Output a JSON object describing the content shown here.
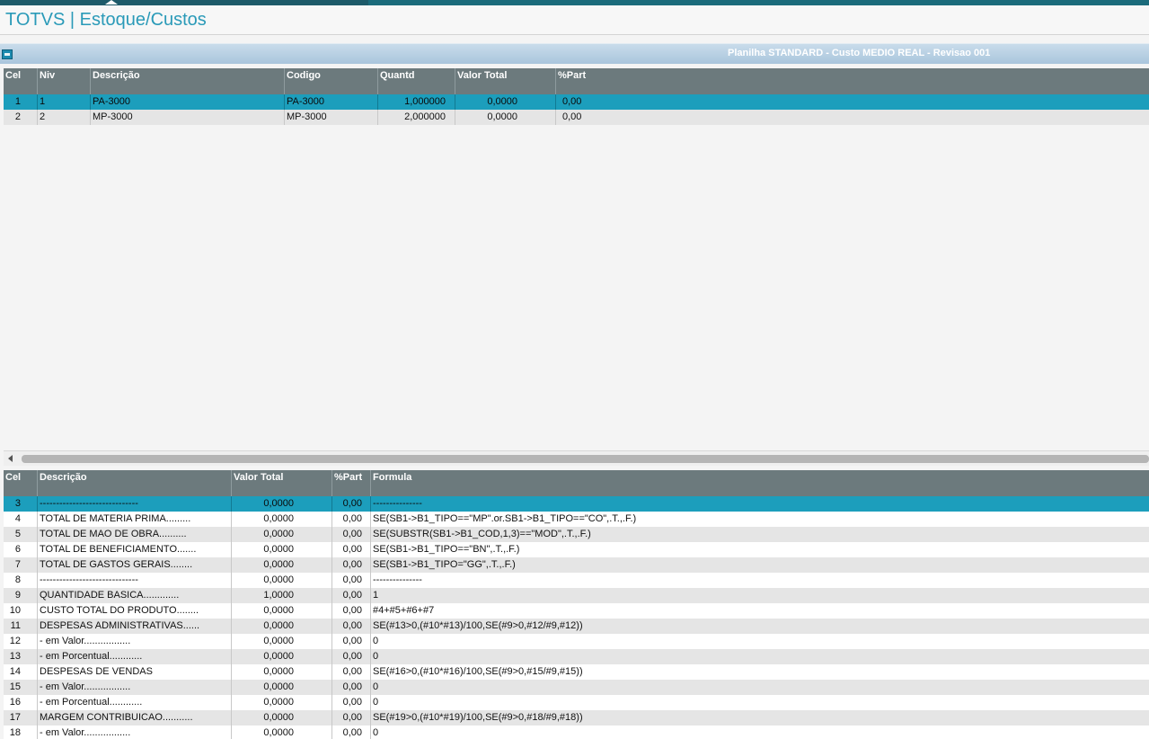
{
  "app": {
    "title": "TOTVS | Estoque/Custos"
  },
  "window": {
    "subtitle": "Planilha STANDARD - Custo MEDIO REAL - Revisao 001"
  },
  "top_table": {
    "headers": {
      "cel": "Cel",
      "niv": "Niv",
      "descricao": "Descrição",
      "codigo": "Codigo",
      "quantd": "Quantd",
      "valor_total": "Valor Total",
      "part": "%Part"
    },
    "rows": [
      {
        "cel": "1",
        "niv": "1",
        "descricao": "PA-3000",
        "codigo": "PA-3000",
        "quantd": "1,000000",
        "valor_total": "0,0000",
        "part": "0,00"
      },
      {
        "cel": "2",
        "niv": " 2",
        "descricao": "MP-3000",
        "codigo": "MP-3000",
        "quantd": "2,000000",
        "valor_total": "0,0000",
        "part": "0,00"
      }
    ]
  },
  "bottom_table": {
    "headers": {
      "cel": "Cel",
      "descricao": "Descrição",
      "valor_total": "Valor Total",
      "part": "%Part",
      "formula": "Formula"
    },
    "rows": [
      {
        "cel": "3",
        "descricao": "------------------------------",
        "valor_total": "0,0000",
        "part": "0,00",
        "formula": "---------------"
      },
      {
        "cel": "4",
        "descricao": "TOTAL DE MATERIA PRIMA.........",
        "valor_total": "0,0000",
        "part": "0,00",
        "formula": "SE(SB1->B1_TIPO==\"MP\".or.SB1->B1_TIPO==\"CO\",.T.,.F.)"
      },
      {
        "cel": "5",
        "descricao": "TOTAL DE MAO DE OBRA..........",
        "valor_total": "0,0000",
        "part": "0,00",
        "formula": "SE(SUBSTR(SB1->B1_COD,1,3)==\"MOD\",.T.,.F.)"
      },
      {
        "cel": "6",
        "descricao": "TOTAL DE BENEFICIAMENTO.......",
        "valor_total": "0,0000",
        "part": "0,00",
        "formula": "SE(SB1->B1_TIPO==\"BN\",.T.,.F.)"
      },
      {
        "cel": "7",
        "descricao": "TOTAL DE GASTOS GERAIS........",
        "valor_total": "0,0000",
        "part": "0,00",
        "formula": "SE(SB1->B1_TIPO=\"GG\",.T.,.F.)"
      },
      {
        "cel": "8",
        "descricao": "------------------------------",
        "valor_total": "0,0000",
        "part": "0,00",
        "formula": "---------------"
      },
      {
        "cel": "9",
        "descricao": "QUANTIDADE BASICA.............",
        "valor_total": "1,0000",
        "part": "0,00",
        "formula": "1"
      },
      {
        "cel": "10",
        "descricao": "CUSTO TOTAL DO PRODUTO........",
        "valor_total": "0,0000",
        "part": "0,00",
        "formula": "#4+#5+#6+#7"
      },
      {
        "cel": "11",
        "descricao": "DESPESAS ADMINISTRATIVAS......",
        "valor_total": "0,0000",
        "part": "0,00",
        "formula": "SE(#13>0,(#10*#13)/100,SE(#9>0,#12/#9,#12))"
      },
      {
        "cel": "12",
        "descricao": "   - em Valor.................",
        "valor_total": "0,0000",
        "part": "0,00",
        "formula": "0"
      },
      {
        "cel": "13",
        "descricao": "   - em Porcentual............",
        "valor_total": "0,0000",
        "part": "0,00",
        "formula": "0"
      },
      {
        "cel": "14",
        "descricao": "DESPESAS DE VENDAS",
        "valor_total": "0,0000",
        "part": "0,00",
        "formula": "SE(#16>0,(#10*#16)/100,SE(#9>0,#15/#9,#15))"
      },
      {
        "cel": "15",
        "descricao": "   - em Valor.................",
        "valor_total": "0,0000",
        "part": "0,00",
        "formula": "0"
      },
      {
        "cel": "16",
        "descricao": "   - em Porcentual............",
        "valor_total": "0,0000",
        "part": "0,00",
        "formula": "0"
      },
      {
        "cel": "17",
        "descricao": "MARGEM CONTRIBUICAO...........",
        "valor_total": "0,0000",
        "part": "0,00",
        "formula": "SE(#19>0,(#10*#19)/100,SE(#9>0,#18/#9,#18))"
      },
      {
        "cel": "18",
        "descricao": "   - em Valor.................",
        "valor_total": "0,0000",
        "part": "0,00",
        "formula": "0"
      }
    ]
  },
  "colors": {
    "accent": "#2a9ab8",
    "selected_row": "#1c9ebc",
    "header_bg": "#6c7a7d"
  },
  "icons": {
    "window": "window-icon",
    "scroll_left": "arrow-left-icon"
  }
}
